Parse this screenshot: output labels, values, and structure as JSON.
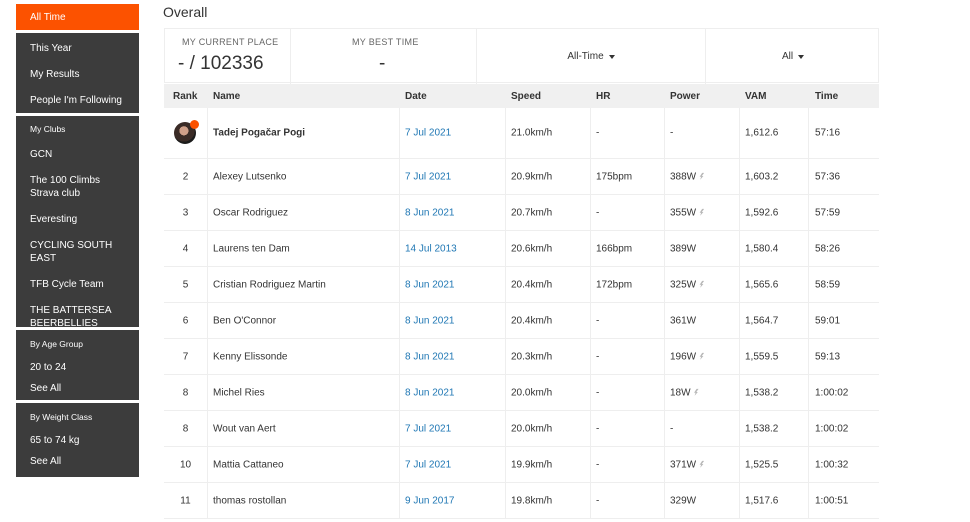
{
  "sidebar": {
    "active": "All Time",
    "group1": [
      "This Year",
      "My Results",
      "People I'm Following"
    ],
    "clubs_head": "My Clubs",
    "clubs": [
      "GCN",
      "The 100 Climbs Strava club",
      "Everesting",
      "CYCLING SOUTH EAST",
      "TFB Cycle Team",
      "THE BATTERSEA BEERBELLIES"
    ],
    "age_head": "By Age Group",
    "age": [
      "20 to 24",
      "See All"
    ],
    "weight_head": "By Weight Class",
    "weight": [
      "65 to 74 kg",
      "See All"
    ]
  },
  "heading": "Overall",
  "stats": {
    "current_label": "MY CURRENT PLACE",
    "current_value": "- / 102336",
    "best_label": "MY BEST TIME",
    "best_value": "-",
    "filter_time": "All-Time",
    "filter_all": "All"
  },
  "columns": [
    "Rank",
    "Name",
    "Date",
    "Speed",
    "HR",
    "Power",
    "VAM",
    "Time"
  ],
  "rows": [
    {
      "rank": "",
      "name": "Tadej Pogačar Pogi",
      "date": "7 Jul 2021",
      "speed": "21.0km/h",
      "hr": "-",
      "power": "-",
      "vam": "1,612.6",
      "time": "57:16"
    },
    {
      "rank": "2",
      "name": "Alexey Lutsenko",
      "date": "7 Jul 2021",
      "speed": "20.9km/h",
      "hr": "175bpm",
      "power": "388W",
      "vam": "1,603.2",
      "time": "57:36"
    },
    {
      "rank": "3",
      "name": "Oscar Rodriguez",
      "date": "8 Jun 2021",
      "speed": "20.7km/h",
      "hr": "-",
      "power": "355W",
      "vam": "1,592.6",
      "time": "57:59"
    },
    {
      "rank": "4",
      "name": "Laurens ten Dam",
      "date": "14 Jul 2013",
      "speed": "20.6km/h",
      "hr": "166bpm",
      "power": "389W",
      "vam": "1,580.4",
      "time": "58:26"
    },
    {
      "rank": "5",
      "name": "Cristian Rodriguez Martin",
      "date": "8 Jun 2021",
      "speed": "20.4km/h",
      "hr": "172bpm",
      "power": "325W",
      "vam": "1,565.6",
      "time": "58:59"
    },
    {
      "rank": "6",
      "name": "Ben O'Connor",
      "date": "8 Jun 2021",
      "speed": "20.4km/h",
      "hr": "-",
      "power": "361W",
      "vam": "1,564.7",
      "time": "59:01"
    },
    {
      "rank": "7",
      "name": "Kenny Elissonde",
      "date": "8 Jun 2021",
      "speed": "20.3km/h",
      "hr": "-",
      "power": "196W",
      "vam": "1,559.5",
      "time": "59:13"
    },
    {
      "rank": "8",
      "name": "Michel Ries",
      "date": "8 Jun 2021",
      "speed": "20.0km/h",
      "hr": "-",
      "power": "18W",
      "vam": "1,538.2",
      "time": "1:00:02"
    },
    {
      "rank": "8",
      "name": "Wout van Aert",
      "date": "7 Jul 2021",
      "speed": "20.0km/h",
      "hr": "-",
      "power": "-",
      "vam": "1,538.2",
      "time": "1:00:02"
    },
    {
      "rank": "10",
      "name": "Mattia Cattaneo",
      "date": "7 Jul 2021",
      "speed": "19.9km/h",
      "hr": "-",
      "power": "371W",
      "vam": "1,525.5",
      "time": "1:00:32"
    },
    {
      "rank": "11",
      "name": "thomas rostollan",
      "date": "9 Jun 2017",
      "speed": "19.8km/h",
      "hr": "-",
      "power": "329W",
      "vam": "1,517.6",
      "time": "1:00:51"
    }
  ],
  "estimated_power_rows": [
    1,
    2,
    4,
    6,
    7,
    9
  ],
  "colors": {
    "accent": "#fc5200",
    "sidebar": "#3c3c3c",
    "link": "#1f77b4"
  }
}
